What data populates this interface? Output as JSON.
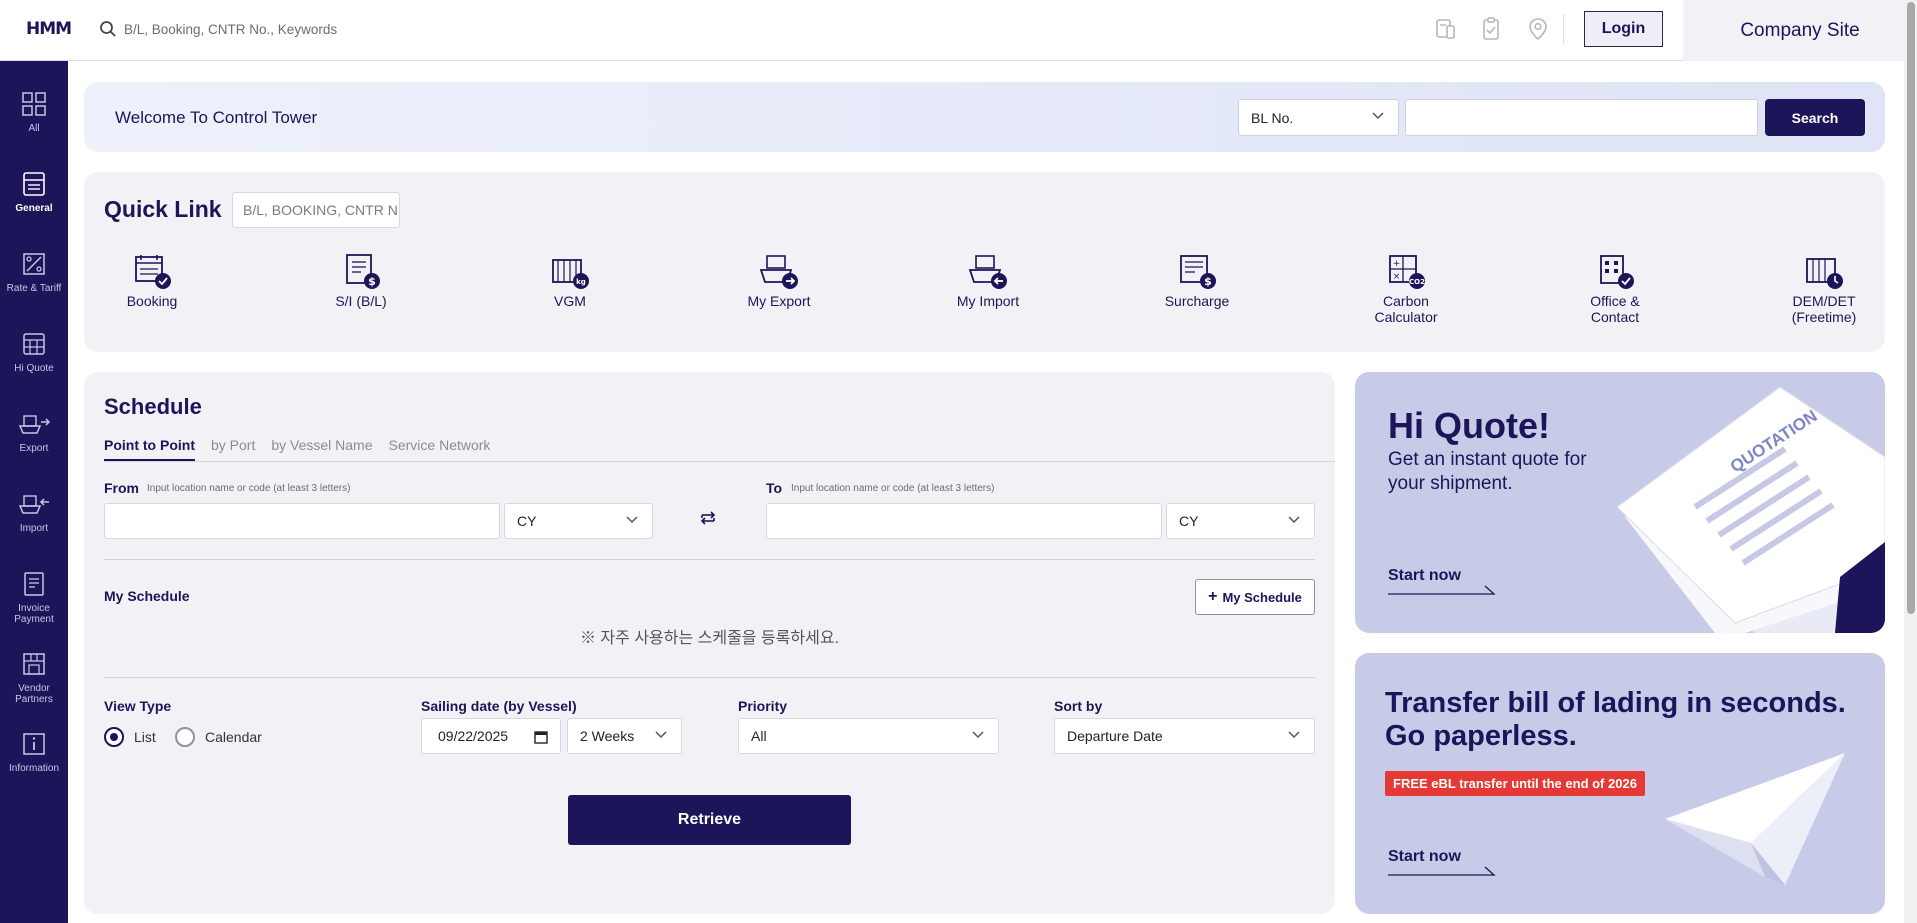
{
  "header": {
    "logo": "HMM",
    "search_placeholder": "B/L, Booking, CNTR No., Keywords",
    "icons": [
      "document-phone-icon",
      "clipboard-check-icon",
      "location-pin-icon"
    ],
    "login_label": "Login",
    "company_site_label": "Company Site"
  },
  "sidebar": {
    "items": [
      {
        "label": "All",
        "icon": "grid-icon"
      },
      {
        "label": "General",
        "icon": "document-icon",
        "active": true
      },
      {
        "label": "Rate & Tariff",
        "icon": "rate-icon"
      },
      {
        "label": "Hi Quote",
        "icon": "calculator-icon"
      },
      {
        "label": "Export",
        "icon": "ship-export-icon"
      },
      {
        "label": "Import",
        "icon": "ship-import-icon"
      },
      {
        "label": "Invoice Payment",
        "icon": "invoice-icon"
      },
      {
        "label": "Vendor Partners",
        "icon": "vendor-icon"
      },
      {
        "label": "Information",
        "icon": "info-icon"
      }
    ]
  },
  "welcome": {
    "title": "Welcome To Control Tower",
    "select_value": "BL No.",
    "search_value": "",
    "search_label": "Search"
  },
  "quicklink": {
    "title": "Quick Link",
    "search_placeholder": "B/L, BOOKING, CNTR N",
    "items": [
      {
        "label": "Booking",
        "icon": "booking-icon"
      },
      {
        "label": "S/I (B/L)",
        "icon": "si-bl-icon"
      },
      {
        "label": "VGM",
        "icon": "vgm-icon"
      },
      {
        "label": "My Export",
        "icon": "my-export-icon"
      },
      {
        "label": "My Import",
        "icon": "my-import-icon"
      },
      {
        "label": "Surcharge",
        "icon": "surcharge-icon"
      },
      {
        "label": "Carbon Calculator",
        "icon": "carbon-calculator-icon"
      },
      {
        "label": "Office & Contact",
        "icon": "office-contact-icon"
      },
      {
        "label": "DEM/DET (Freetime)",
        "icon": "dem-det-icon"
      }
    ]
  },
  "schedule": {
    "title": "Schedule",
    "tabs": [
      "Point to Point",
      "by Port",
      "by Vessel Name",
      "Service Network"
    ],
    "active_tab": "Point to Point",
    "from_label": "From",
    "to_label": "To",
    "location_hint": "Input location name or code (at least 3 letters)",
    "from_value": "",
    "to_value": "",
    "from_type": "CY",
    "to_type": "CY",
    "my_schedule_label": "My Schedule",
    "my_schedule_button": "My Schedule",
    "my_schedule_empty": "※ 자주 사용하는 스케줄을 등록하세요.",
    "view_type_label": "View Type",
    "view_options": [
      "List",
      "Calendar"
    ],
    "view_selected": "List",
    "sailing_label": "Sailing date (by Vessel)",
    "sailing_date": "09/22/2025",
    "sailing_range": "2 Weeks",
    "priority_label": "Priority",
    "priority_value": "All",
    "sort_label": "Sort by",
    "sort_value": "Departure Date",
    "retrieve_label": "Retrieve"
  },
  "promo_quote": {
    "title": "Hi Quote!",
    "subtitle": "Get an instant quote for your shipment.",
    "paper_text": "QUOTATION",
    "cta": "Start now"
  },
  "promo_ebl": {
    "title": "Transfer bill of lading in seconds. Go paperless.",
    "badge": "FREE eBL transfer until the end of 2026",
    "cta": "Start now"
  },
  "colors": {
    "brand_navy": "#1c1559",
    "panel_bg": "#f2f2f6",
    "promo_bg": "#c7cbe8",
    "badge_red": "#e53935"
  }
}
